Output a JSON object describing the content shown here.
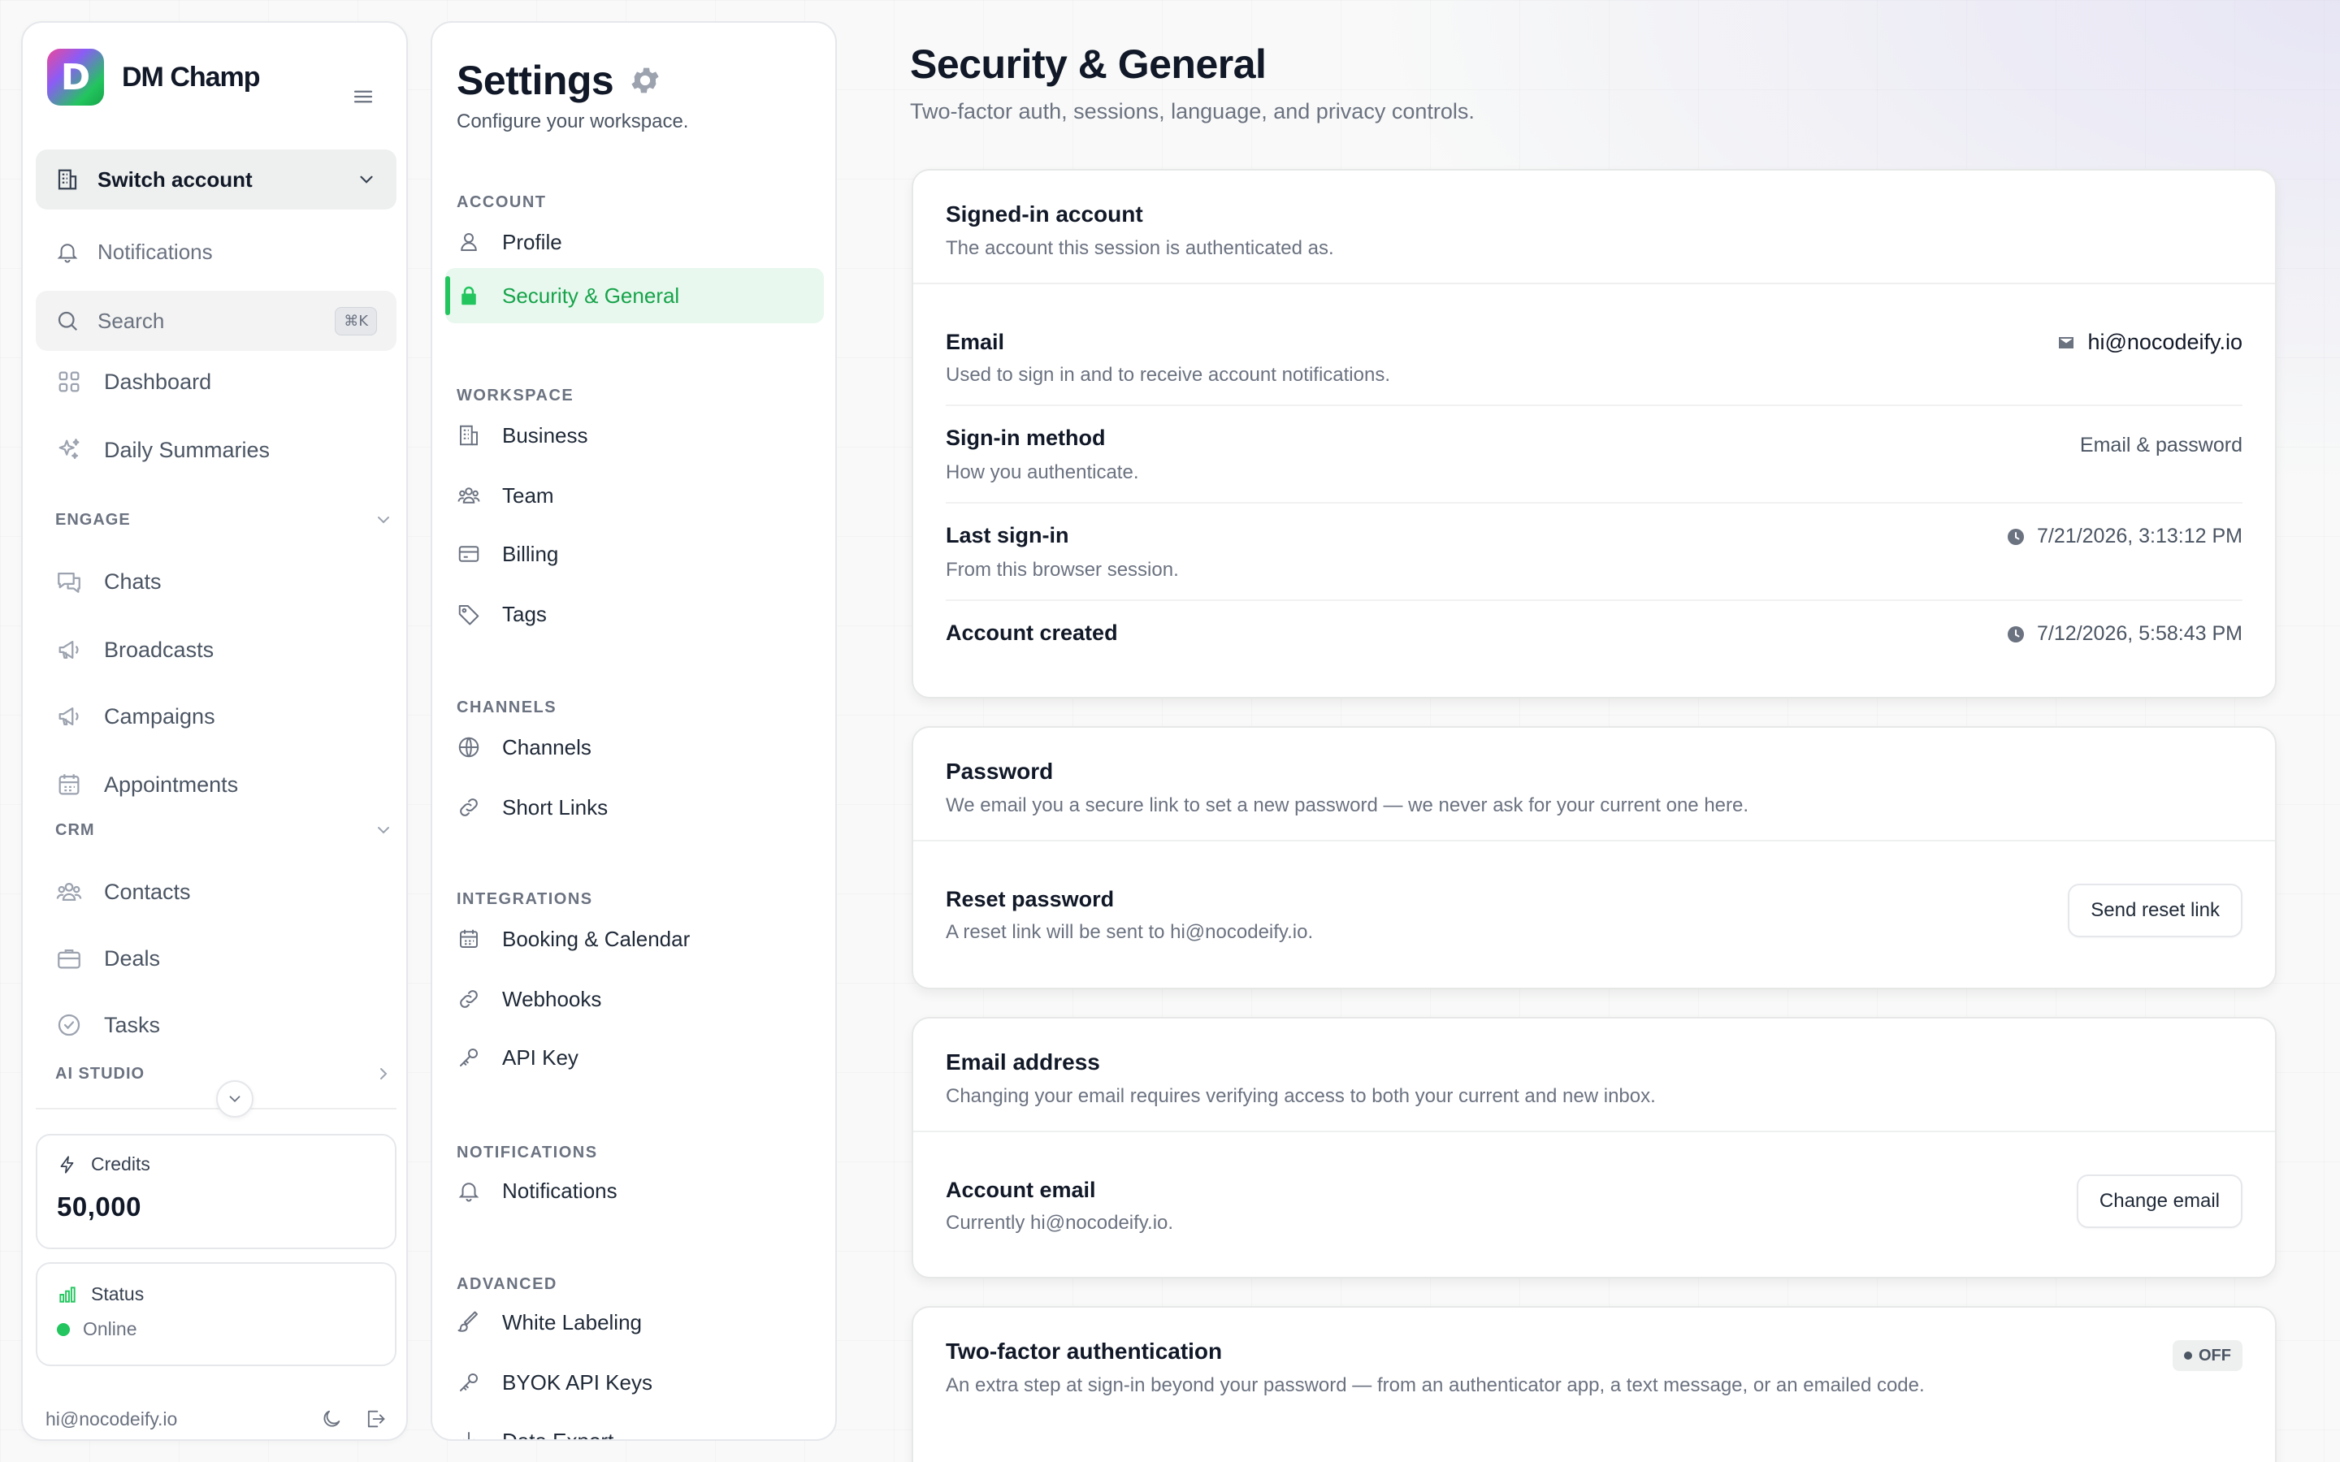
{
  "app": {
    "brand_name": "DM Champ",
    "brand_letter": "D"
  },
  "sidebar": {
    "switch_account": "Switch account",
    "notifications": "Notifications",
    "search": {
      "label": "Search",
      "shortcut": "⌘K"
    },
    "items": [
      {
        "label": "Dashboard",
        "icon": "dashboard-icon"
      },
      {
        "label": "Daily Summaries",
        "icon": "sparkles-icon"
      }
    ],
    "sections": {
      "engage": {
        "label": "ENGAGE",
        "items": [
          {
            "label": "Chats",
            "icon": "chat-icon"
          },
          {
            "label": "Broadcasts",
            "icon": "megaphone-icon"
          },
          {
            "label": "Campaigns",
            "icon": "megaphone-icon"
          },
          {
            "label": "Appointments",
            "icon": "calendar-icon"
          }
        ]
      },
      "crm": {
        "label": "CRM",
        "items": [
          {
            "label": "Contacts",
            "icon": "users-icon"
          },
          {
            "label": "Deals",
            "icon": "briefcase-icon"
          },
          {
            "label": "Tasks",
            "icon": "check-circle-icon"
          }
        ]
      },
      "ai_studio": {
        "label": "AI STUDIO"
      }
    },
    "credits": {
      "label": "Credits",
      "value": "50,000"
    },
    "status": {
      "label": "Status",
      "value": "Online",
      "color": "#22c55e"
    },
    "footer_email": "hi@nocodeify.io"
  },
  "settings_nav": {
    "title": "Settings",
    "subtitle": "Configure your workspace.",
    "sections": {
      "account": {
        "label": "ACCOUNT",
        "items": [
          "Profile",
          "Security & General"
        ]
      },
      "workspace": {
        "label": "WORKSPACE",
        "items": [
          "Business",
          "Team",
          "Billing",
          "Tags"
        ]
      },
      "channels": {
        "label": "CHANNELS",
        "items": [
          "Channels",
          "Short Links"
        ]
      },
      "integrations": {
        "label": "INTEGRATIONS",
        "items": [
          "Booking & Calendar",
          "Webhooks",
          "API Key"
        ]
      },
      "notifications": {
        "label": "NOTIFICATIONS",
        "items": [
          "Notifications"
        ]
      },
      "advanced": {
        "label": "ADVANCED",
        "items": [
          "White Labeling",
          "BYOK API Keys",
          "Data Export"
        ]
      }
    },
    "active_item": "Security & General",
    "accent_color": "#22c55e"
  },
  "main": {
    "title": "Security & General",
    "subtitle": "Two-factor auth, sessions, language, and privacy controls.",
    "signed_in": {
      "title": "Signed-in account",
      "desc": "The account this session is authenticated as.",
      "rows": [
        {
          "title": "Email",
          "desc": "Used to sign in and to receive account notifications.",
          "value": "hi@nocodeify.io"
        },
        {
          "title": "Sign-in method",
          "desc": "How you authenticate.",
          "value": "Email & password"
        },
        {
          "title": "Last sign-in",
          "desc": "From this browser session.",
          "value": "7/21/2026, 3:13:12 PM"
        },
        {
          "title": "Account created",
          "value": "7/12/2026, 5:58:43 PM"
        }
      ]
    },
    "password": {
      "title": "Password",
      "desc": "We email you a secure link to set a new password — we never ask for your current one here.",
      "row": {
        "title": "Reset password",
        "desc": "A reset link will be sent to hi@nocodeify.io.",
        "button": "Send reset link"
      }
    },
    "email_address": {
      "title": "Email address",
      "desc": "Changing your email requires verifying access to both your current and new inbox.",
      "row": {
        "title": "Account email",
        "desc": "Currently hi@nocodeify.io.",
        "button": "Change email"
      }
    },
    "two_factor": {
      "title": "Two-factor authentication",
      "desc": "An extra step at sign-in beyond your password — from an authenticator app, a text message, or an emailed code.",
      "badge": "OFF"
    }
  }
}
